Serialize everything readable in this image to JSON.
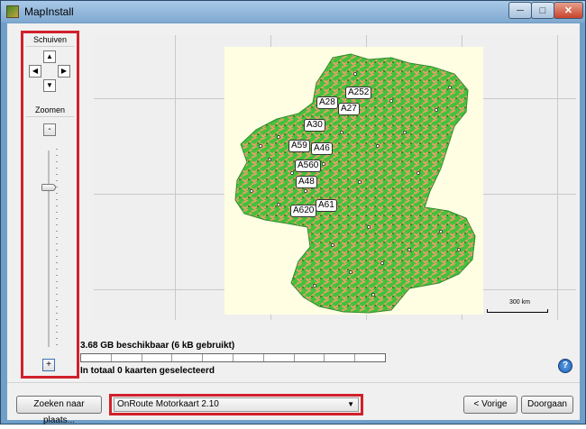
{
  "window": {
    "title": "MapInstall",
    "minimize_icon": "minimize-icon",
    "maximize_icon": "maximize-icon",
    "close_icon": "close-icon"
  },
  "side_panel": {
    "scroll_label": "Schuiven",
    "zoom_label": "Zoomen",
    "zoom_out_label": "-",
    "zoom_in_label": "+",
    "arrow_icons": [
      "arrow-up-icon",
      "arrow-left-icon",
      "arrow-right-icon",
      "arrow-down-icon"
    ],
    "zoom_level_fraction": 0.2,
    "frame_color": "#d1212b"
  },
  "map": {
    "road_labels": [
      "A28",
      "A252",
      "A27",
      "A30",
      "A59",
      "A46",
      "A560",
      "A48",
      "A61",
      "A620"
    ],
    "scale_label": "300 km",
    "colors": {
      "land": "#42c23a",
      "urban": "#e3a06a",
      "background": "#fffee2"
    }
  },
  "status": {
    "available": "3.68 GB beschikbaar (6 kB gebruikt)",
    "selected": "In totaal 0 kaarten geselecteerd",
    "progress_fraction": 0
  },
  "footer": {
    "search_label": "Zoeken naar plaats...",
    "map_select_value": "OnRoute Motorkaart 2.10",
    "back_label": "< Vorige",
    "next_label": "Doorgaan"
  }
}
